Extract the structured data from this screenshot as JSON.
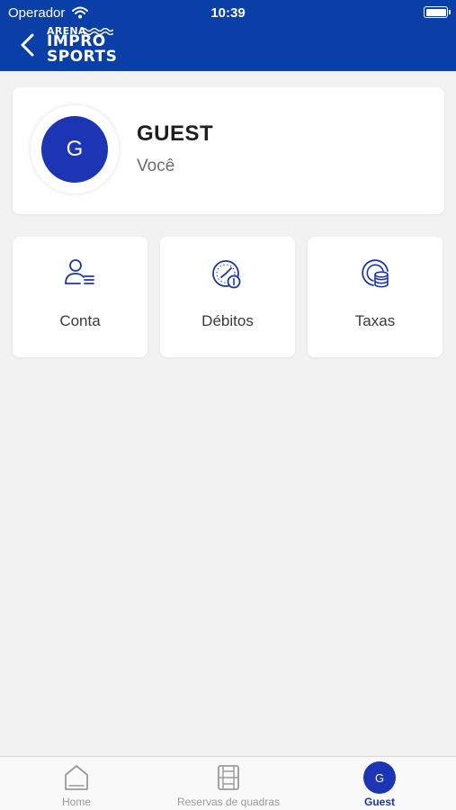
{
  "status_bar": {
    "carrier": "Operador",
    "time": "10:39"
  },
  "header": {
    "logo_line1": "ARENA",
    "logo_line2": "IMPRO",
    "logo_line3": "SPORTS",
    "bg_color": "#0a3fa8"
  },
  "profile": {
    "initial": "G",
    "name": "GUEST",
    "role": "Você"
  },
  "tiles": [
    {
      "label": "Conta",
      "icon": "user-list-icon"
    },
    {
      "label": "Débitos",
      "icon": "clock-dollar-icon"
    },
    {
      "label": "Taxas",
      "icon": "coins-icon"
    }
  ],
  "tabbar": {
    "items": [
      {
        "label": "Home",
        "icon": "home-icon",
        "active": false
      },
      {
        "label": "Reservas de quadras",
        "icon": "court-icon",
        "active": false
      },
      {
        "label": "Guest",
        "initial": "G",
        "active": true
      }
    ],
    "accent": "#1b35b4"
  }
}
